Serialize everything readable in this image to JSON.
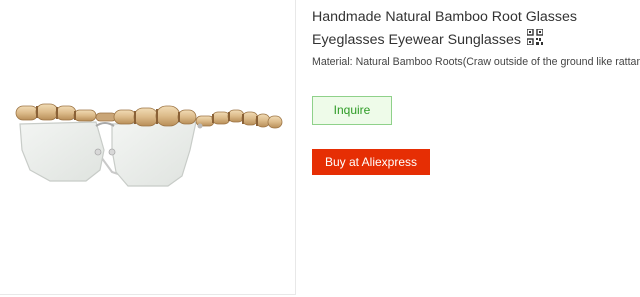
{
  "product": {
    "title": "Handmade Natural Bamboo Root Glasses Eyeglasses Eyewear Sunglasses",
    "material": "Material: Natural Bamboo Roots(Craw outside of the ground like rattan)",
    "image_alt": "Bamboo root frame glasses with clear lenses",
    "qr_icon": "qr-code-icon"
  },
  "actions": {
    "inquire_label": "Inquire",
    "buy_label": "Buy at Aliexpress"
  },
  "colors": {
    "buy_button": "#e62e04",
    "inquire_border": "#8fd18a",
    "inquire_text": "#2e9b26",
    "bamboo": "#d9b98a"
  }
}
